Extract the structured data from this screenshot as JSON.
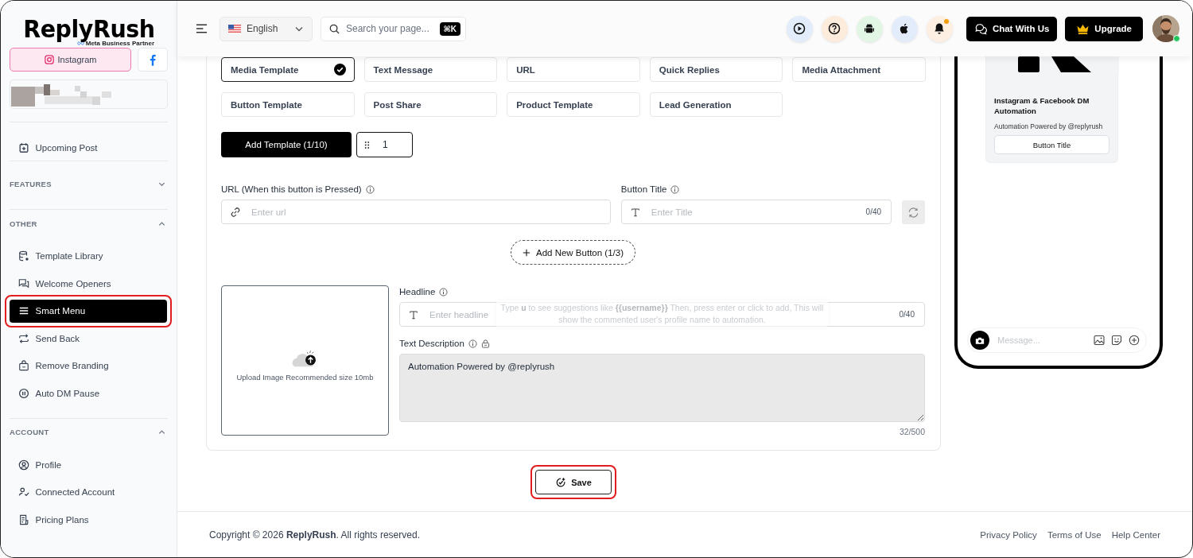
{
  "sidebar": {
    "logo": "ReplyRush",
    "partner_badge": "Meta Business Partner",
    "platforms": [
      {
        "kind": "instagram",
        "label": "Instagram",
        "selected": true
      },
      {
        "kind": "facebook",
        "selected": false
      }
    ],
    "pinned": [
      {
        "label": "Upcoming Post",
        "selected": false,
        "highlighted": false
      }
    ],
    "sections": [
      {
        "title": "FEATURES",
        "expanded": false
      },
      {
        "title": "OTHER",
        "expanded": true,
        "items": [
          {
            "label": "Template Library",
            "selected": false,
            "highlighted": false
          },
          {
            "label": "Welcome Openers",
            "selected": false,
            "highlighted": false
          },
          {
            "label": "Smart Menu",
            "selected": true,
            "highlighted": true
          },
          {
            "label": "Send Back",
            "selected": false,
            "highlighted": false
          },
          {
            "label": "Remove Branding",
            "selected": false,
            "highlighted": false
          },
          {
            "label": "Auto DM Pause",
            "selected": false,
            "highlighted": false
          }
        ]
      },
      {
        "title": "ACCOUNT",
        "expanded": true,
        "items": [
          {
            "label": "Profile",
            "selected": false,
            "highlighted": false
          },
          {
            "label": "Connected Account",
            "selected": false,
            "highlighted": false
          },
          {
            "label": "Pricing Plans",
            "selected": false,
            "highlighted": false
          }
        ]
      }
    ]
  },
  "header": {
    "language": "English",
    "search": {
      "placeholder": "Search your page...",
      "shortcut": "⌘K"
    },
    "icon_buttons": [
      {
        "kind": "video",
        "notification": false
      },
      {
        "kind": "help",
        "notification": false
      },
      {
        "kind": "android",
        "notification": false
      },
      {
        "kind": "apple",
        "notification": false
      },
      {
        "kind": "bell",
        "notification": true
      }
    ],
    "chat_button": "Chat With Us",
    "upgrade_button": "Upgrade",
    "avatar": {
      "online": true
    }
  },
  "templates": [
    {
      "label": "Media Template",
      "selected": true
    },
    {
      "label": "Text Message",
      "selected": false
    },
    {
      "label": "URL",
      "selected": false
    },
    {
      "label": "Quick Replies",
      "selected": false
    },
    {
      "label": "Media Attachment",
      "selected": false
    },
    {
      "label": "Button Template",
      "selected": false
    },
    {
      "label": "Post Share",
      "selected": false
    },
    {
      "label": "Product Template",
      "selected": false
    },
    {
      "label": "Lead Generation",
      "selected": false
    }
  ],
  "add_template": "Add Template (1/10)",
  "template_index": "1",
  "url_field": {
    "label": "URL (When this button is Pressed)",
    "placeholder": "Enter url"
  },
  "button_title_field": {
    "label": "Button Title",
    "placeholder": "Enter Title",
    "counter": "0/40"
  },
  "add_button": "Add New Button (1/3)",
  "upload": {
    "text": "Upload Image Recommended size 10mb"
  },
  "headline_field": {
    "label": "Headline",
    "placeholder": "Enter headline",
    "counter": "0/40"
  },
  "tooltip": "Type **u** to see suggestions like **{{username}}** Then, press enter or click to add, This will show the commented user's profile name to automation.",
  "description_field": {
    "label": "Text Description",
    "value": "Automation Powered by @replyrush",
    "counter": "32/500",
    "disabled": true
  },
  "save_button": {
    "label": "Save",
    "highlighted": true
  },
  "preview": {
    "title": "Instagram & Facebook DM Automation",
    "text": "Automation Powered by @replyrush",
    "button": "Button Title",
    "message_placeholder": "Message..."
  },
  "footer": {
    "copyright": "Copyright © 2026 **ReplyRush**. All rights reserved.",
    "links": [
      "Privacy Policy",
      "Terms of Use",
      "Help Center"
    ]
  }
}
